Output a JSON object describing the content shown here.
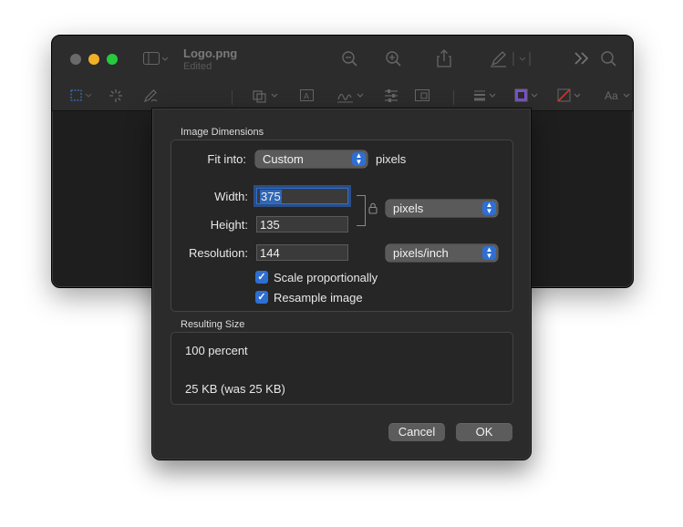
{
  "window": {
    "title": "Logo.png",
    "subtitle": "Edited",
    "traffic_lights": [
      "#6a6a6a",
      "#f0b129",
      "#27c93f"
    ]
  },
  "toolbar_icons": [
    "sidebar-icon",
    "zoom-out-icon",
    "zoom-in-icon",
    "share-icon",
    "markup-icon",
    "more-icon",
    "search-icon",
    "selection-icon",
    "instant-alpha-icon",
    "sketch-icon",
    "shapes-icon",
    "text-icon",
    "sign-icon",
    "adjust-color-icon",
    "adjust-size-icon",
    "border-style-icon",
    "border-color-icon",
    "fill-color-icon",
    "text-style-icon"
  ],
  "toolbar_text": {
    "text_style": "Aa"
  },
  "dialog": {
    "image_dimensions_label": "Image Dimensions",
    "fit_into_label": "Fit into:",
    "fit_into_value": "Custom",
    "fit_into_unit": "pixels",
    "width_label": "Width:",
    "width_value": "375",
    "height_label": "Height:",
    "height_value": "135",
    "size_unit_value": "pixels",
    "resolution_label": "Resolution:",
    "resolution_value": "144",
    "resolution_unit_value": "pixels/inch",
    "scale_proportionally_label": "Scale proportionally",
    "scale_proportionally_checked": true,
    "resample_label": "Resample image",
    "resample_checked": true,
    "resulting_size_label": "Resulting Size",
    "resulting_percent": "100 percent",
    "resulting_kb": "25 KB (was 25 KB)",
    "cancel_label": "Cancel",
    "ok_label": "OK"
  },
  "colors": {
    "accent": "#2f6fd3",
    "window_bg": "#1e1e1e",
    "sheet_bg": "#2b2b2b"
  }
}
